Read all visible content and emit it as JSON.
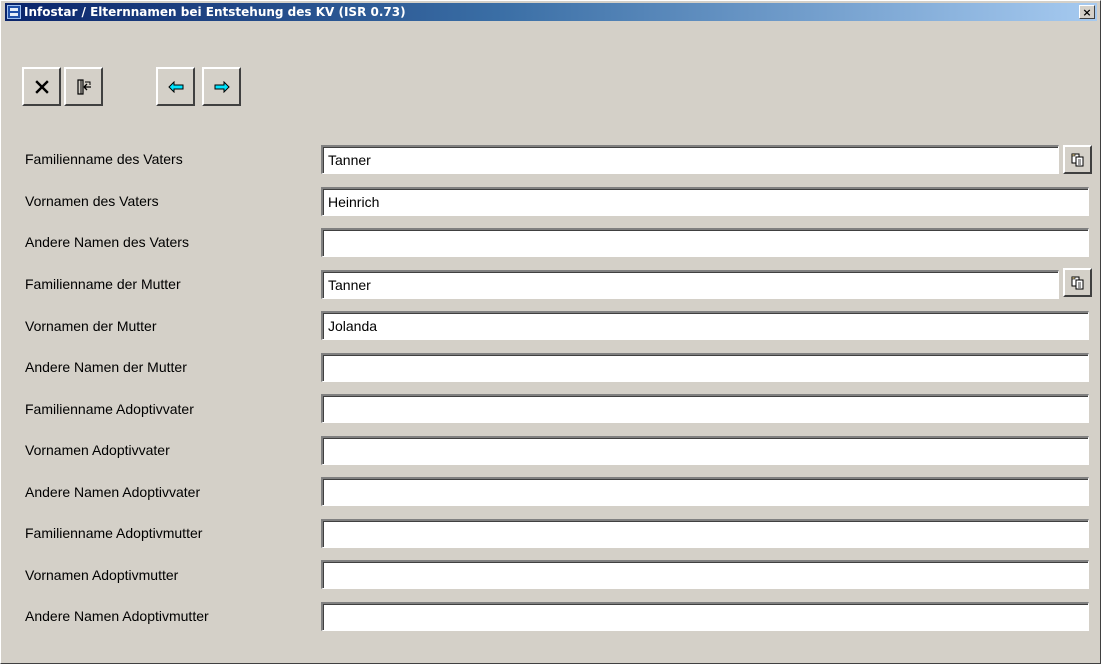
{
  "window": {
    "title": "Infostar / Elternnamen bei Entstehung des KV (ISR 0.73)",
    "close_glyph": "×",
    "icon": "app-icon",
    "title_gradient": [
      "#0a246a",
      "#a6caf0"
    ]
  },
  "toolbar": {
    "buttons": [
      {
        "icon": "close-x-icon",
        "color": "#000000"
      },
      {
        "icon": "exit-door-icon",
        "color": "#000000"
      },
      {
        "icon": "arrow-left-icon",
        "color": "#00b4c8"
      },
      {
        "icon": "arrow-right-icon",
        "color": "#00b4c8"
      }
    ]
  },
  "form": {
    "fields": [
      {
        "label": "Familienname des Vaters",
        "value": "Tanner",
        "has_copy": true
      },
      {
        "label": "Vornamen des Vaters",
        "value": "Heinrich",
        "has_copy": false
      },
      {
        "label": "Andere Namen des Vaters",
        "value": "",
        "has_copy": false
      },
      {
        "label": "Familienname der Mutter",
        "value": "Tanner",
        "has_copy": true
      },
      {
        "label": "Vornamen der Mutter",
        "value": "Jolanda",
        "has_copy": false
      },
      {
        "label": "Andere Namen der Mutter",
        "value": "",
        "has_copy": false
      },
      {
        "label": "Familienname Adoptivvater",
        "value": "",
        "has_copy": false
      },
      {
        "label": "Vornamen Adoptivvater",
        "value": "",
        "has_copy": false
      },
      {
        "label": "Andere Namen Adoptivvater",
        "value": "",
        "has_copy": false
      },
      {
        "label": "Familienname Adoptivmutter",
        "value": "",
        "has_copy": false
      },
      {
        "label": "Vornamen Adoptivmutter",
        "value": "",
        "has_copy": false
      },
      {
        "label": "Andere Namen Adoptivmutter",
        "value": "",
        "has_copy": false
      }
    ]
  },
  "colors": {
    "background": "#d4d0c8",
    "input_bg": "#ffffff",
    "arrow_accent": "#00b4c8"
  }
}
